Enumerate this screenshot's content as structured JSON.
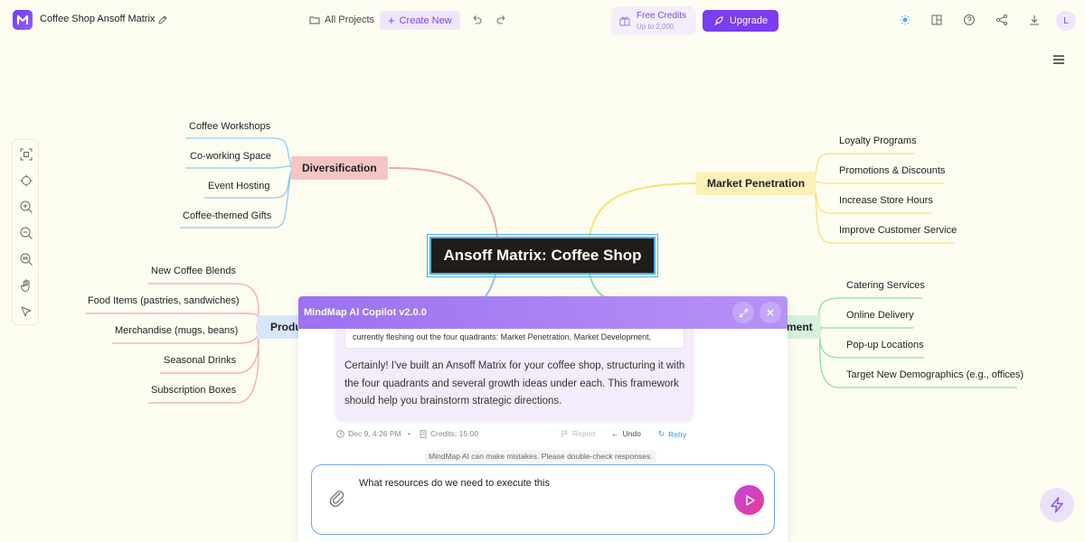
{
  "header": {
    "doc_title": "Coffee Shop Ansoff Matrix",
    "all_projects": "All Projects",
    "create_new": "Create New",
    "credits_title": "Free Credits",
    "credits_sub": "Up to 2,000",
    "upgrade": "Upgrade",
    "avatar_letter": "L"
  },
  "map": {
    "root": "Ansoff Matrix: Coffee Shop",
    "diversification": {
      "label": "Diversification",
      "items": [
        "Coffee Workshops",
        "Co-working Space",
        "Event Hosting",
        "Coffee-themed Gifts"
      ]
    },
    "market_penetration": {
      "label": "Market Penetration",
      "items": [
        "Loyalty Programs",
        "Promotions & Discounts",
        "Increase Store Hours",
        "Improve Customer Service"
      ]
    },
    "product_development": {
      "label": "Produ",
      "items": [
        "New Coffee Blends",
        "Food Items (pastries, sandwiches)",
        "Merchandise (mugs, beans)",
        "Seasonal Drinks",
        "Subscription Boxes"
      ]
    },
    "market_development": {
      "label": "ment",
      "items": [
        "Catering Services",
        "Online Delivery",
        "Pop-up Locations",
        "Target New Demographics (e.g., offices)"
      ]
    }
  },
  "copilot": {
    "title": "MindMap AI Copilot v2.0.0",
    "quote": "currently fleshing out the four quadrants: Market Penetration, Market Development,",
    "message": "Certainly! I've built an Ansoff Matrix for your coffee shop, structuring it with the four quadrants and several growth ideas under each. This framework should help you brainstorm strategic directions.",
    "timestamp": "Dec 9, 4:26 PM",
    "credits": "Credits: 15.00",
    "report": "Report",
    "undo": "Undo",
    "retry": "Retry",
    "disclaimer": "MindMap AI can make mistakes. Please double-check responses.",
    "input_value": "What resources do we need to execute this"
  },
  "colors": {
    "accent": "#7a3df0",
    "diversification": "#f7c4c4",
    "market_penetration": "#fdf1b8",
    "product_development": "#d8e6fb",
    "market_development": "#d5f1dd"
  }
}
